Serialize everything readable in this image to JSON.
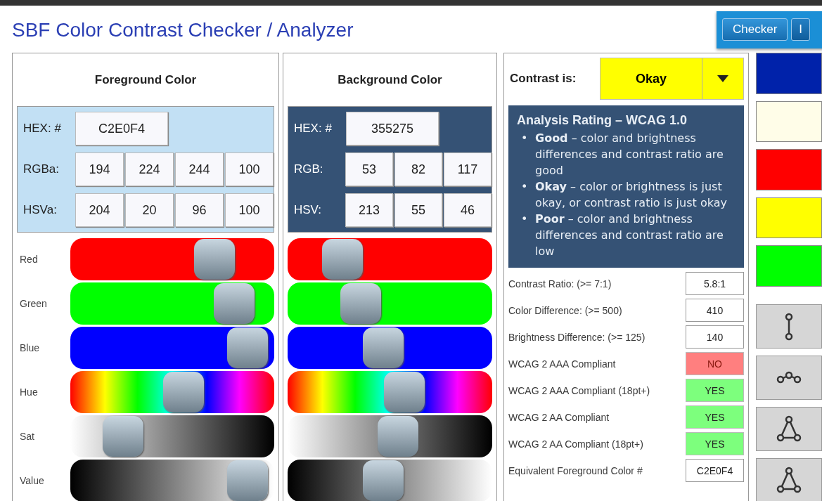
{
  "title": "SBF Color Contrast Checker / Analyzer",
  "toolbar": [
    {
      "label": "Checker",
      "selected": true
    },
    {
      "label": "I",
      "selected": false
    }
  ],
  "panels": [
    {
      "title": "Foreground Color",
      "hex_label": "HEX: #",
      "hex": "C2E0F4",
      "rows": [
        {
          "label": "RGBa:",
          "values": [
            "194",
            "224",
            "244",
            "100"
          ]
        },
        {
          "label": "HSVa:",
          "values": [
            "204",
            "20",
            "96",
            "100"
          ]
        }
      ],
      "sliders": [
        {
          "kind": "red",
          "label": "Red",
          "level": 0.76
        },
        {
          "kind": "green",
          "label": "Green",
          "level": 0.88
        },
        {
          "kind": "blue",
          "label": "Blue",
          "level": 0.96
        },
        {
          "kind": "hue",
          "label": "Hue",
          "level": 0.57
        },
        {
          "kind": "sat",
          "label": "Sat",
          "level": 0.2
        },
        {
          "kind": "value",
          "label": "Value",
          "level": 0.96
        }
      ]
    },
    {
      "title": "Background Color",
      "hex_label": "HEX: #",
      "hex": "355275",
      "rows": [
        {
          "label": "RGB:",
          "values": [
            "53",
            "82",
            "117"
          ]
        },
        {
          "label": "HSV:",
          "values": [
            "213",
            "55",
            "46"
          ]
        }
      ],
      "sliders": [
        {
          "kind": "red",
          "level": 0.21
        },
        {
          "kind": "green",
          "level": 0.32
        },
        {
          "kind": "blue",
          "level": 0.46
        },
        {
          "kind": "hue",
          "level": 0.59
        },
        {
          "kind": "sat",
          "level": 0.55
        },
        {
          "kind": "value",
          "level": 0.46
        }
      ]
    }
  ],
  "contrast": {
    "label": "Contrast is:",
    "value": "Okay"
  },
  "analysis": {
    "title": "Analysis Rating – WCAG 1.0",
    "items": [
      {
        "marker": "•",
        "text": "**Good** – color and brightness differences and contrast ratio are good"
      },
      {
        "marker": "•",
        "text": "**Okay** – color or brightness is just okay, or contrast ratio is just okay"
      },
      {
        "marker": "•",
        "text": "**Poor** – color and brightness differences and contrast ratio are low"
      }
    ]
  },
  "results": [
    {
      "kind": "value",
      "label": "Contrast Ratio: (>= 7:1)",
      "value": "5.8:1"
    },
    {
      "kind": "value",
      "label": "Color Difference: (>= 500)",
      "value": "410"
    },
    {
      "kind": "value",
      "label": "Brightness Difference: (>= 125)",
      "value": "140"
    },
    {
      "kind": "check",
      "label": "WCAG 2 AAA Compliant",
      "value": "NO",
      "passed": false
    },
    {
      "kind": "check",
      "label": "WCAG 2 AAA Compliant (18pt+)",
      "value": "YES",
      "passed": true
    },
    {
      "kind": "check",
      "label": "WCAG 2 AA Compliant",
      "value": "YES",
      "passed": true
    },
    {
      "kind": "check",
      "label": "WCAG 2 AA Compliant (18pt+)",
      "value": "YES",
      "passed": true
    },
    {
      "kind": "value",
      "label": "Equivalent Foreground Color #",
      "value": "C2E0F4"
    }
  ],
  "swatches": [
    {
      "color": "#0022aa"
    },
    {
      "color": "#fffde8"
    },
    {
      "color": "#ff0000"
    },
    {
      "color": "#ffff00"
    },
    {
      "color": "#00ff00"
    }
  ]
}
